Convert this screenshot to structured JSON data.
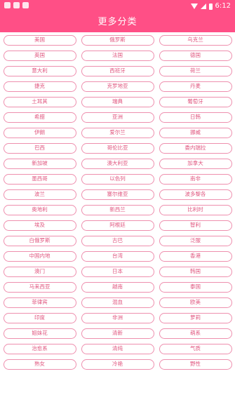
{
  "status_bar": {
    "time": "6:12",
    "icons": [
      "notification-icon",
      "notification-icon",
      "notification-icon",
      "wifi-icon",
      "signal-icon",
      "battery-icon"
    ]
  },
  "header": {
    "title": "更多分类"
  },
  "colors": {
    "accent": "#ff4f86",
    "button_border": "#ee8fae",
    "button_text": "#e0567f"
  },
  "categories": [
    "美国",
    "俄罗斯",
    "乌克兰",
    "英国",
    "法国",
    "德国",
    "意大利",
    "西班牙",
    "荷兰",
    "捷克",
    "克罗地亚",
    "丹麦",
    "土耳其",
    "瑞典",
    "葡萄牙",
    "希腊",
    "亚洲",
    "日韩",
    "伊朗",
    "爱尔兰",
    "挪威",
    "巴西",
    "哥伦比亚",
    "委内瑞拉",
    "新加坡",
    "澳大利亚",
    "加拿大",
    "墨西哥",
    "以色列",
    "南非",
    "波兰",
    "塞尔维亚",
    "波多黎各",
    "奥地利",
    "新西兰",
    "比利时",
    "埃及",
    "阿根廷",
    "智利",
    "白俄罗斯",
    "古巴",
    "泛服",
    "中国内地",
    "台湾",
    "香港",
    "澳门",
    "日本",
    "韩国",
    "马来西亚",
    "越南",
    "泰国",
    "菲律宾",
    "混血",
    "欧美",
    "印度",
    "非洲",
    "萝莉",
    "姐妹花",
    "清新",
    "萌系",
    "治愈系",
    "清纯",
    "气质",
    "熟女",
    "冷艳",
    "野性"
  ]
}
